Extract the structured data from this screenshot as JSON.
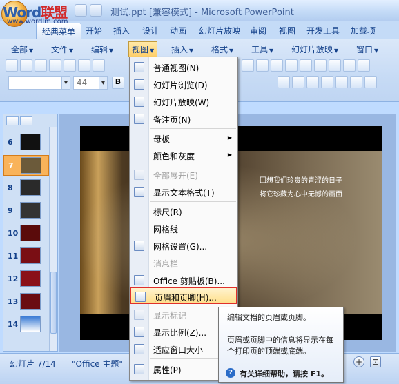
{
  "watermark": {
    "brand_a": "Word",
    "brand_b": "联盟",
    "url": "www.wordlm.com"
  },
  "window": {
    "title": "测试.ppt [兼容模式] - Microsoft PowerPoint"
  },
  "tabs": [
    "经典菜单",
    "开始",
    "插入",
    "设计",
    "动画",
    "幻灯片放映",
    "审阅",
    "视图",
    "开发工具",
    "加载项"
  ],
  "menubar": [
    "全部",
    "文件",
    "编辑",
    "视图",
    "插入",
    "格式",
    "工具",
    "幻灯片放映",
    "窗口"
  ],
  "font_size_value": "44",
  "bold_label": "B",
  "view_menu": {
    "items": [
      {
        "label": "普通视图(N)",
        "disabled": false,
        "icon": "normal-view-icon"
      },
      {
        "label": "幻灯片浏览(D)",
        "disabled": false,
        "icon": "slide-sorter-icon"
      },
      {
        "label": "幻灯片放映(W)",
        "disabled": false,
        "icon": "slideshow-icon"
      },
      {
        "label": "备注页(N)",
        "disabled": false,
        "icon": "notes-page-icon"
      },
      {
        "label": "母板",
        "disabled": false,
        "submenu": true,
        "icon": ""
      },
      {
        "label": "颜色和灰度",
        "disabled": false,
        "submenu": true,
        "icon": ""
      },
      {
        "label": "全部展开(E)",
        "disabled": true,
        "icon": "expand-all-icon"
      },
      {
        "label": "显示文本格式(T)",
        "disabled": false,
        "icon": "text-format-icon"
      },
      {
        "label": "标尺(R)",
        "disabled": false,
        "icon": ""
      },
      {
        "label": "网格线",
        "disabled": false,
        "icon": ""
      },
      {
        "label": "网格设置(G)...",
        "disabled": false,
        "icon": "grid-icon"
      },
      {
        "label": "消息栏",
        "disabled": true,
        "icon": ""
      },
      {
        "label": "Office 剪贴板(B)...",
        "disabled": false,
        "icon": "clipboard-icon"
      },
      {
        "label": "页眉和页脚(H)...",
        "disabled": false,
        "icon": "header-footer-icon",
        "highlight": true
      },
      {
        "label": "显示标记",
        "disabled": true,
        "icon": "markup-icon"
      },
      {
        "label": "显示比例(Z)...",
        "disabled": false,
        "icon": "zoom-icon"
      },
      {
        "label": "适应窗口大小",
        "disabled": false,
        "icon": "fit-window-icon"
      },
      {
        "label": "属性(P)",
        "disabled": false,
        "icon": "properties-icon"
      }
    ]
  },
  "tooltip": {
    "title": "编辑文档的页眉或页脚。",
    "body": "页眉或页脚中的信息将显示在每个打印页的顶端或底端。",
    "help": "有关详细帮助，请按 F1。"
  },
  "slides": {
    "thumbnails": [
      {
        "num": "6",
        "selected": false
      },
      {
        "num": "7",
        "selected": true
      },
      {
        "num": "8",
        "selected": false
      },
      {
        "num": "9",
        "selected": false
      },
      {
        "num": "10",
        "selected": false
      },
      {
        "num": "11",
        "selected": false
      },
      {
        "num": "12",
        "selected": false
      },
      {
        "num": "13",
        "selected": false
      },
      {
        "num": "14",
        "selected": false
      }
    ],
    "current_text_1": "回想我们珍贵的青涩的日子",
    "current_text_2": "将它珍藏为心中无憾的画面"
  },
  "statusbar": {
    "slide_counter": "幻灯片 7/14",
    "theme": "\"Office 主题\""
  }
}
